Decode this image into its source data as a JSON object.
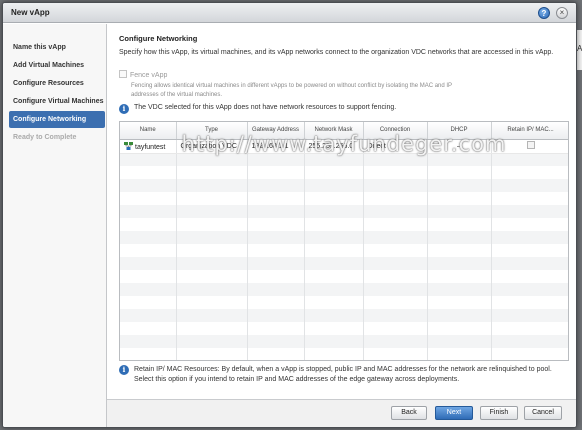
{
  "window": {
    "title": "New vApp"
  },
  "backdrop": {
    "partial_text": "vAp"
  },
  "sidebar": {
    "steps": [
      {
        "label": "Name this vApp",
        "state": "normal"
      },
      {
        "label": "Add Virtual Machines",
        "state": "normal"
      },
      {
        "label": "Configure Resources",
        "state": "normal"
      },
      {
        "label": "Configure Virtual Machines",
        "state": "normal"
      },
      {
        "label": "Configure Networking",
        "state": "active"
      },
      {
        "label": "Ready to Complete",
        "state": "disabled"
      }
    ]
  },
  "main": {
    "heading": "Configure Networking",
    "description": "Specify how this vApp, its virtual machines, and its vApp networks connect to the organization VDC networks that are accessed in this vApp.",
    "fence_label": "Fence vApp",
    "fence_checked": false,
    "fence_note": "Fencing allows identical virtual machines in different vApps to be powered on without conflict by isolating the MAC and IP addresses of the virtual machines.",
    "vdc_notice": "The VDC selected for this vApp does not have network resources to support fencing.",
    "table": {
      "columns": [
        "Name",
        "Type",
        "Gateway Address",
        "Network Mask",
        "Connection",
        "DHCP",
        "Retain IP/ MAC..."
      ],
      "rows": [
        {
          "name": "tayfuntest",
          "type": "Organization VDC",
          "gateway": "192.168.1.1",
          "mask": "255.255.255.0",
          "connection": "Direct",
          "dhcp": "–",
          "retain": false
        }
      ]
    },
    "watermark": "http://www.tayfundeger.com",
    "retain_note": "Retain IP/ MAC Resources: By default, when a vApp is stopped, public IP and MAC addresses for the network are relinquished to pool. Select this option if you intend to retain IP and MAC addresses of the edge gateway across deployments."
  },
  "footer": {
    "back_label": "Back",
    "next_label": "Next",
    "finish_label": "Finish",
    "cancel_label": "Cancel"
  },
  "colors": {
    "active_step": "#3c6fb0",
    "info_icon": "#2f6db6",
    "primary_button": "#2f6cb6"
  }
}
